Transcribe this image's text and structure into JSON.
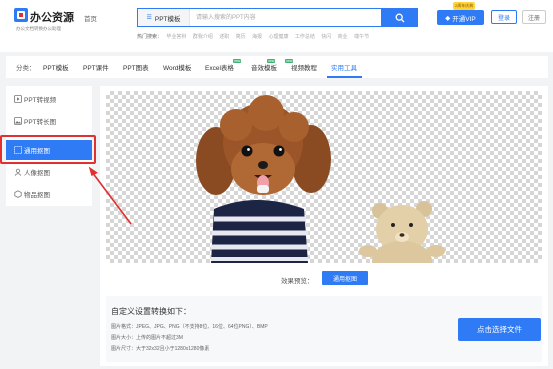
{
  "header": {
    "logo_title": "办公资源",
    "logo_subtitle": "办公文档转换办公助理",
    "home_link": "首页",
    "search": {
      "category": "PPT模板",
      "placeholder": "请输入搜索的PPT内容"
    },
    "hot_label": "热门搜索：",
    "hot_words": [
      "毕业答辩",
      "群我介绍",
      "述职",
      "简历",
      "海报",
      "心理健康",
      "工作总结",
      "快闪",
      "商业",
      "端午节"
    ],
    "vip_label": "开通VIP",
    "vip_badge": "2周年庆典",
    "login_label": "登录",
    "register_label": "注册"
  },
  "catbar": {
    "label": "分类：",
    "items": [
      {
        "label": "PPT模板",
        "active": false,
        "new": false
      },
      {
        "label": "PPT课件",
        "active": false,
        "new": false
      },
      {
        "label": "PPT图表",
        "active": false,
        "new": false
      },
      {
        "label": "Word模板",
        "active": false,
        "new": false
      },
      {
        "label": "Excel表格",
        "active": false,
        "new": true
      },
      {
        "label": "音效模板",
        "active": false,
        "new": true
      },
      {
        "label": "视频教程",
        "active": false,
        "new": true
      },
      {
        "label": "实用工具",
        "active": true,
        "new": false
      }
    ],
    "new_tag": "new"
  },
  "sidebar": {
    "items": [
      {
        "label": "PPT转视频",
        "icon": "play-video-icon",
        "active": false
      },
      {
        "label": "PPT转长图",
        "icon": "image-icon",
        "active": false
      },
      {
        "label": "通用抠图",
        "icon": "cutout-icon",
        "active": true
      },
      {
        "label": "人像抠图",
        "icon": "portrait-icon",
        "active": false
      },
      {
        "label": "物品抠图",
        "icon": "object-icon",
        "active": false
      }
    ]
  },
  "main": {
    "preview_label": "效果预览：",
    "preview_button": "通用抠图",
    "settings_title": "自定义设置转换如下：",
    "settings_lines": [
      "图片格式：JPEG、JPG、PNG（不支持8位、16位、64位PNG）、BMP",
      "图片大小：上传的图片不超过3M",
      "图片尺寸：大于32x32且小于1280x1280像素"
    ],
    "upload_button": "点击选择文件"
  },
  "colors": {
    "accent": "#2f7bf5",
    "highlight": "#e03030",
    "background": "#f2f3f5"
  }
}
